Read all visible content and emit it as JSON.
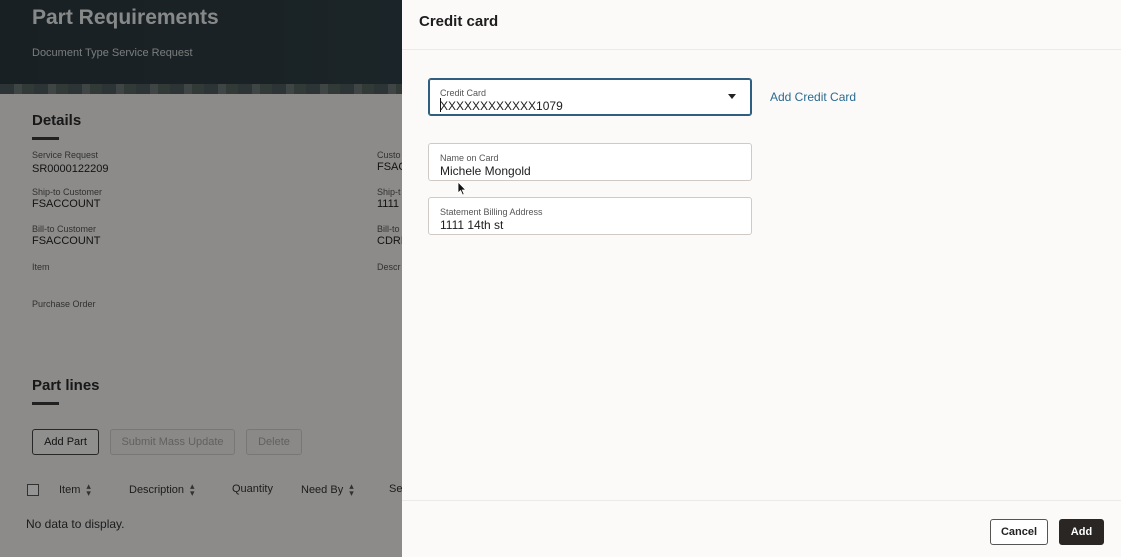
{
  "background": {
    "title": "Part Requirements",
    "subtitle": "Document Type Service Request",
    "details": {
      "heading": "Details",
      "service_request_label": "Service Request",
      "service_request_value": "SR0000122209",
      "ship_to_label": "Ship-to Customer",
      "ship_to_value": "FSACCOUNT",
      "bill_to_label": "Bill-to Customer",
      "bill_to_value": "FSACCOUNT",
      "item_label": "Item",
      "purchase_order_label": "Purchase Order",
      "col2_label1": "Custo",
      "col2_value1": "FSAC",
      "col2_label2": "Ship-t",
      "col2_value2": "1111",
      "col2_label3": "Bill-to",
      "col2_value3": "CDRM",
      "col2_label4": "Descr"
    },
    "part_lines": {
      "heading": "Part lines",
      "add_part": "Add Part",
      "submit_mass_update": "Submit Mass Update",
      "delete": "Delete",
      "columns": [
        "Item",
        "Description",
        "Quantity",
        "Need By",
        "Se"
      ],
      "no_data": "No data to display."
    }
  },
  "drawer": {
    "title": "Credit card",
    "credit_card": {
      "label": "Credit Card",
      "value": "XXXXXXXXXXXX1079"
    },
    "add_credit_card_link": "Add Credit Card",
    "name_on_card": {
      "label": "Name on Card",
      "value": "Michele Mongold"
    },
    "billing_address": {
      "label": "Statement Billing Address",
      "value": "1111 14th st"
    },
    "footer": {
      "cancel": "Cancel",
      "add": "Add"
    }
  },
  "colors": {
    "accent_link": "#2b6b8f",
    "focus_border": "#2e5f7f",
    "primary_button": "#2a2624",
    "header_bg": "#2c3a3f"
  }
}
